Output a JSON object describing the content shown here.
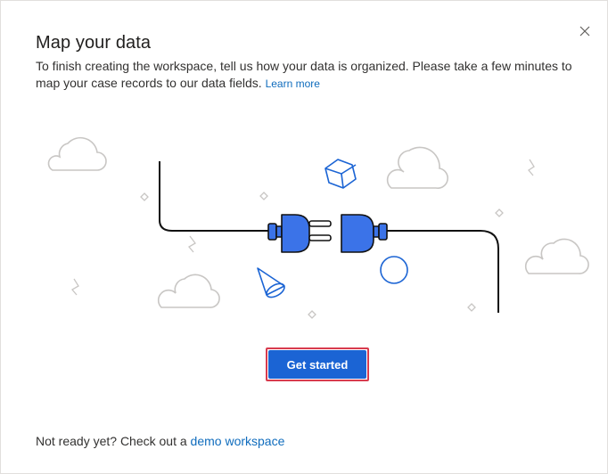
{
  "dialog": {
    "title": "Map your data",
    "description": "To finish creating the workspace, tell us how your data is organized. Please take a few minutes to map your case records to our data fields.",
    "learn_more": "Learn more",
    "primary_button": "Get started",
    "footer_text": "Not ready yet? Check out a",
    "footer_link": "demo workspace"
  },
  "icons": {
    "close": "close-icon",
    "plug": "plug-icon",
    "socket": "socket-icon"
  },
  "colors": {
    "accent": "#1b64d4",
    "link": "#0f6cbd",
    "focus_outline": "#d83b4e",
    "plug_fill": "#3b73e8"
  }
}
